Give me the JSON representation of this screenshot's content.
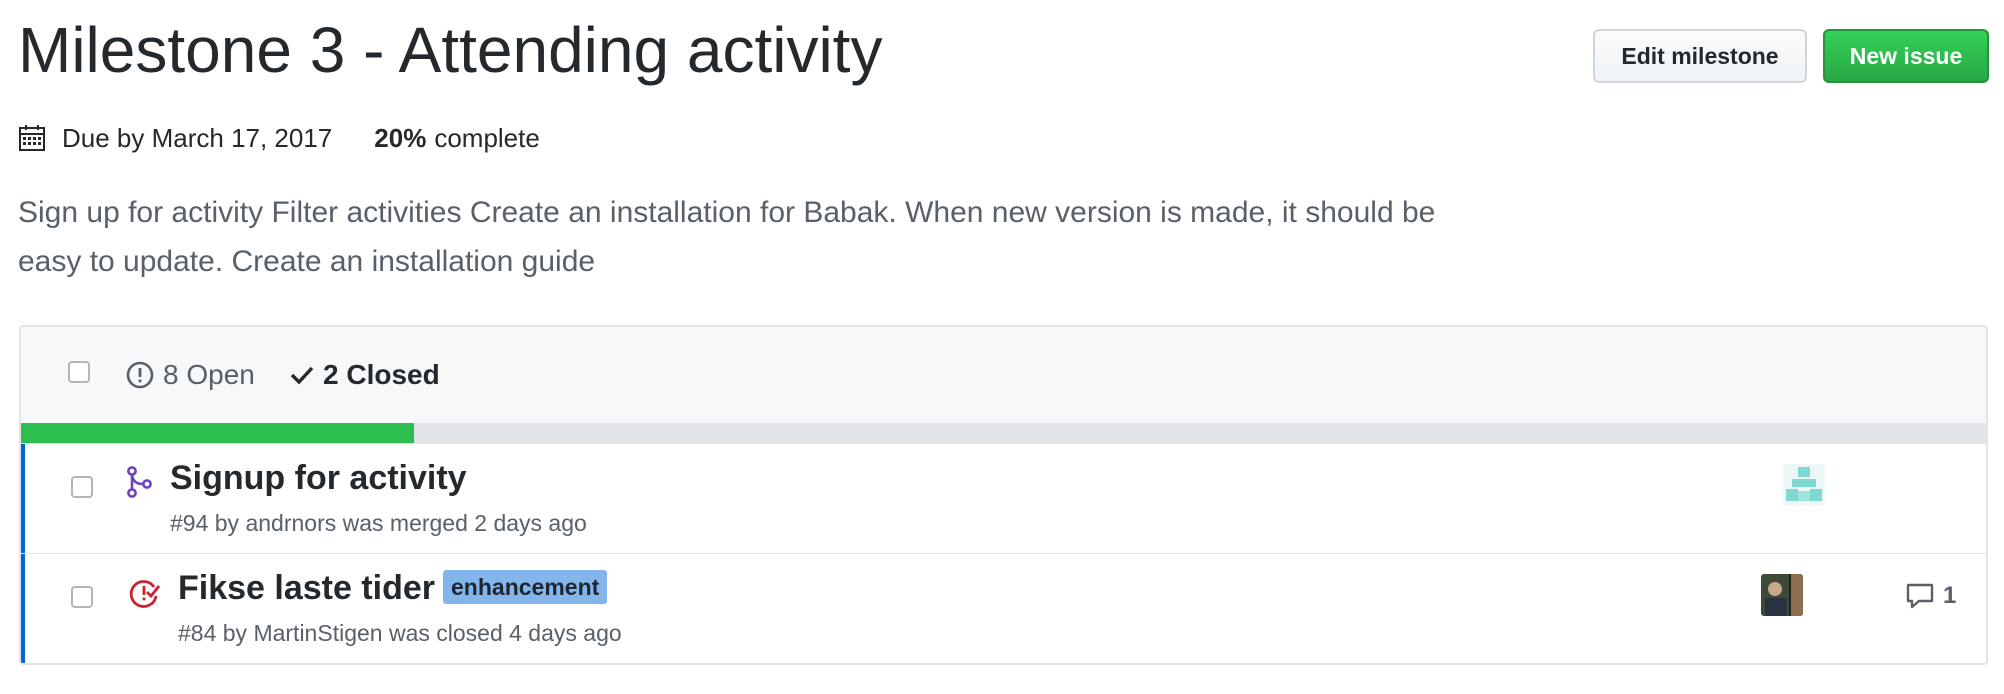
{
  "milestone": {
    "title": "Milestone 3 - Attending activity",
    "due": "Due by March 17, 2017",
    "percent": "20%",
    "percent_suffix": "complete",
    "progress_fraction": 0.2,
    "description": "Sign up for activity Filter activities Create an installation for Babak. When new version is made, it should be easy to update. Create an installation guide"
  },
  "buttons": {
    "edit": "Edit milestone",
    "new": "New issue"
  },
  "states": {
    "open": "8 Open",
    "closed": "2 Closed"
  },
  "issues": [
    {
      "title": "Signup for activity",
      "label": "",
      "meta": "#94 by andrnors was merged 2 days ago",
      "icon": "merged-pr-icon",
      "comments": ""
    },
    {
      "title": "Fikse laste tider",
      "label": "enhancement",
      "meta": "#84 by MartinStigen was closed 4 days ago",
      "icon": "closed-issue-icon",
      "comments": "1"
    }
  ],
  "colors": {
    "accent_green": "#2cbe4e",
    "merged_purple": "#6f42c1",
    "closed_red": "#cb2431",
    "label_bg": "#84b6eb",
    "row_bar": "#0366d6"
  }
}
